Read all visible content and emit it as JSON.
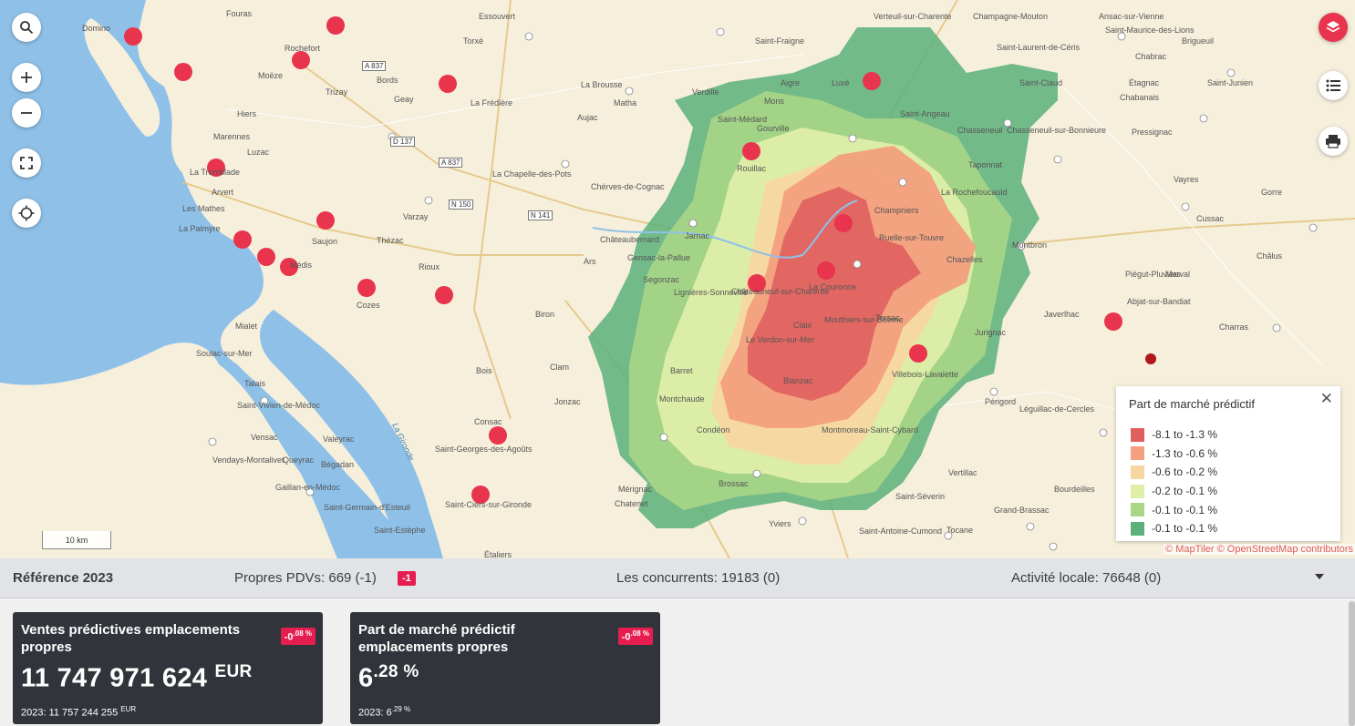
{
  "map": {
    "scale_label": "10 km",
    "attribution": "© MapTiler © OpenStreetMap contributors",
    "places": [
      {
        "name": "Fouras"
      },
      {
        "name": "Domino"
      },
      {
        "name": "Essouvert"
      },
      {
        "name": "Verteuil-sur-Charente"
      },
      {
        "name": "Champagne-Mouton"
      },
      {
        "name": "Ansac-sur-Vienne"
      },
      {
        "name": "Rochefort"
      },
      {
        "name": "Torxé"
      },
      {
        "name": "Saint-Fraigne"
      },
      {
        "name": "Saint-Laurent-de-Céris"
      },
      {
        "name": "Saint-Maurice-des-Lions"
      },
      {
        "name": "Brigueuil"
      },
      {
        "name": "Moëze"
      },
      {
        "name": "Bords"
      },
      {
        "name": "Aigre"
      },
      {
        "name": "Luxé"
      },
      {
        "name": "Saint-Claud"
      },
      {
        "name": "Chabrac"
      },
      {
        "name": "Étagnac"
      },
      {
        "name": "Saint-Junien"
      },
      {
        "name": "Trizay"
      },
      {
        "name": "La Brousse"
      },
      {
        "name": "Matha"
      },
      {
        "name": "Verdille"
      },
      {
        "name": "Saint-Médard"
      },
      {
        "name": "Mons"
      },
      {
        "name": "Saint-Angeau"
      },
      {
        "name": "Chabanais"
      },
      {
        "name": "Hiers"
      },
      {
        "name": "Geay"
      },
      {
        "name": "La Frédière"
      },
      {
        "name": "Aujac"
      },
      {
        "name": "Gourville"
      },
      {
        "name": "Chasseneuil-sur-Bonnieure"
      },
      {
        "name": "Chasseneuil"
      },
      {
        "name": "Marennes"
      },
      {
        "name": "Pressignac"
      },
      {
        "name": "Luzac"
      },
      {
        "name": "Rouillac"
      },
      {
        "name": "Taponnat"
      },
      {
        "name": "La Tremblade"
      },
      {
        "name": "La Chapelle-des-Pots"
      },
      {
        "name": "Chérves-de-Cognac"
      },
      {
        "name": "Champniers"
      },
      {
        "name": "La Rochefoucauld"
      },
      {
        "name": "Vayres"
      },
      {
        "name": "Gorre"
      },
      {
        "name": "Arvert"
      },
      {
        "name": "Les Mathes"
      },
      {
        "name": "Varzay"
      },
      {
        "name": "Cussac"
      },
      {
        "name": "La Palmyre"
      },
      {
        "name": "Saujon"
      },
      {
        "name": "Thézac"
      },
      {
        "name": "Châteaubernard"
      },
      {
        "name": "Jarnac"
      },
      {
        "name": "Ruelle-sur-Touvre"
      },
      {
        "name": "Montbron"
      },
      {
        "name": "Châlus"
      },
      {
        "name": "Médis"
      },
      {
        "name": "Rioux"
      },
      {
        "name": "Ars"
      },
      {
        "name": "Gensac-la-Pallue"
      },
      {
        "name": "Chazelles"
      },
      {
        "name": "Marval"
      },
      {
        "name": "Segonzac"
      },
      {
        "name": "Piégut-Pluviers"
      },
      {
        "name": "Châteauneuf-sur-Charente"
      },
      {
        "name": "La Couronne"
      },
      {
        "name": "Abjat-sur-Bandiat"
      },
      {
        "name": "Cozes"
      },
      {
        "name": "Biron"
      },
      {
        "name": "Lignières-Sonneville"
      },
      {
        "name": "Claix"
      },
      {
        "name": "Mouthiers-sur-Boëme"
      },
      {
        "name": "Torsac"
      },
      {
        "name": "Javerlhac"
      },
      {
        "name": "Le Verdon-sur-Mer"
      },
      {
        "name": "Jurignac"
      },
      {
        "name": "Charras"
      },
      {
        "name": "Mialet"
      },
      {
        "name": "Soulac-sur-Mer"
      },
      {
        "name": "Bois"
      },
      {
        "name": "Clam"
      },
      {
        "name": "Barret"
      },
      {
        "name": "Blanzac"
      },
      {
        "name": "Villebois-Lavalette"
      },
      {
        "name": "Talais"
      },
      {
        "name": "Jonzac"
      },
      {
        "name": "Montchaude"
      },
      {
        "name": "Saint-Vivien-de-Médoc"
      },
      {
        "name": "Consac"
      },
      {
        "name": "Condéon"
      },
      {
        "name": "Périgord"
      },
      {
        "name": "Vensac"
      },
      {
        "name": "Valeyrac"
      },
      {
        "name": "Montmoreau-Saint-Cybard"
      },
      {
        "name": "Léguillac-de-Cercles"
      },
      {
        "name": "Saint-Georges-des-Agoûts"
      },
      {
        "name": "Vendays-Montalivet"
      },
      {
        "name": "Queyrac"
      },
      {
        "name": "Bégadan"
      },
      {
        "name": "Brossac"
      },
      {
        "name": "Vertillac"
      },
      {
        "name": "Mérignac"
      },
      {
        "name": "Gaillan-en-Médoc"
      },
      {
        "name": "Saint-Germain-d'Esteuil"
      },
      {
        "name": "Saint-Ciers-sur-Gironde"
      },
      {
        "name": "Chatenet"
      },
      {
        "name": "Saint-Séverin"
      },
      {
        "name": "Bourdeilles"
      },
      {
        "name": "Grand-Brassac"
      },
      {
        "name": "Yviers"
      },
      {
        "name": "Saint-Antoine-Cumond"
      },
      {
        "name": "Tocane"
      },
      {
        "name": "Saint-Estèphe"
      },
      {
        "name": "Étaliers"
      },
      {
        "name": "La Gironde"
      }
    ],
    "roads": [
      "A 837",
      "D 137",
      "A 837",
      "N 150",
      "N 141"
    ]
  },
  "legend": {
    "title": "Part de marché prédictif",
    "close": "✕",
    "items": [
      {
        "label": "-8.1 to -1.3 %",
        "color": "#e0605f"
      },
      {
        "label": "-1.3 to -0.6 %",
        "color": "#f2a07e"
      },
      {
        "label": "-0.6 to -0.2 %",
        "color": "#f7d7a1"
      },
      {
        "label": "-0.2 to -0.1 %",
        "color": "#dfeea9"
      },
      {
        "label": "-0.1 to -0.1 %",
        "color": "#a9d687"
      },
      {
        "label": "-0.1 to -0.1 %",
        "color": "#5cb07a"
      }
    ]
  },
  "status": {
    "reference": "Référence 2023",
    "pdv": "Propres PDVs: 669 (-1)",
    "pdv_badge": "-1",
    "concurrents": "Les concurrents: 19183 (0)",
    "activite": "Activité locale: 76648 (0)"
  },
  "cards": [
    {
      "title": "Ventes prédictives emplacements propres",
      "badge_int": "-0",
      "badge_dec": ".08 %",
      "value_main": "11 747 971 624",
      "value_unit": "EUR",
      "prev_main": "2023: 11 757 244 255",
      "prev_unit": "EUR"
    },
    {
      "title": "Part de marché prédictif emplacements propres",
      "badge_int": "-0",
      "badge_dec": ".08 %",
      "value_main": "6",
      "value_unit": ".28 %",
      "prev_main": "2023: 6",
      "prev_unit": ".29 %"
    }
  ],
  "colors": {
    "accent": "#e8344c",
    "badge": "#e61e50",
    "card_bg": "#31353b",
    "water": "#8fc1e8",
    "land": "#f6efdc"
  }
}
